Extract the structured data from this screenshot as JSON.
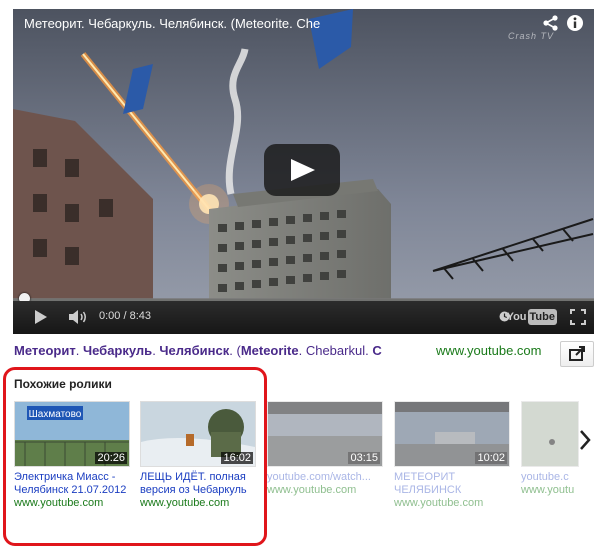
{
  "player": {
    "title": "Метеорит. Чебаркуль. Челябинск. (Meteorite. Che",
    "channel_logo": "Crash TV",
    "time": "0:00 / 8:43",
    "progress_fraction": 0,
    "brand": {
      "you": "You",
      "tube": "Tube"
    },
    "icons": [
      "share-icon",
      "info-icon",
      "play-icon",
      "volume-icon",
      "watch-later-icon",
      "fullscreen-icon"
    ]
  },
  "info": {
    "title_parts": [
      "Метеорит",
      ". ",
      "Чебаркуль",
      ". ",
      "Челябинск",
      ". (",
      "Meteorite",
      ". Chebarkul. ",
      "C"
    ],
    "url": "www.youtube.com",
    "external_icon": "external-link-icon"
  },
  "related": {
    "heading": "Похожие ролики",
    "items": [
      {
        "title": "Электричка Миасс - Челябинск 21.07.2012",
        "duration": "20:26",
        "url": "www.youtube.com",
        "sign": "Шахматово"
      },
      {
        "title": "ЛЕЩЬ ИДЁТ. полная версия оз Чебаркуль",
        "duration": "16:02",
        "url": "www.youtube.com"
      },
      {
        "title": "youtube.com/watch...",
        "duration": "03:15",
        "url": "www.youtube.com"
      },
      {
        "title": "МЕТЕОРИТ ЧЕЛЯБИНСК",
        "duration": "10:02",
        "url": "www.youtube.com"
      },
      {
        "title": "youtube.c",
        "duration": "",
        "url": "www.youtu"
      }
    ],
    "next_icon": "chevron-right-icon"
  },
  "colors": {
    "highlight_border": "#e0151b",
    "link": "#1a3dc1",
    "url": "#1a7a1a",
    "title": "#4a2a8a"
  }
}
